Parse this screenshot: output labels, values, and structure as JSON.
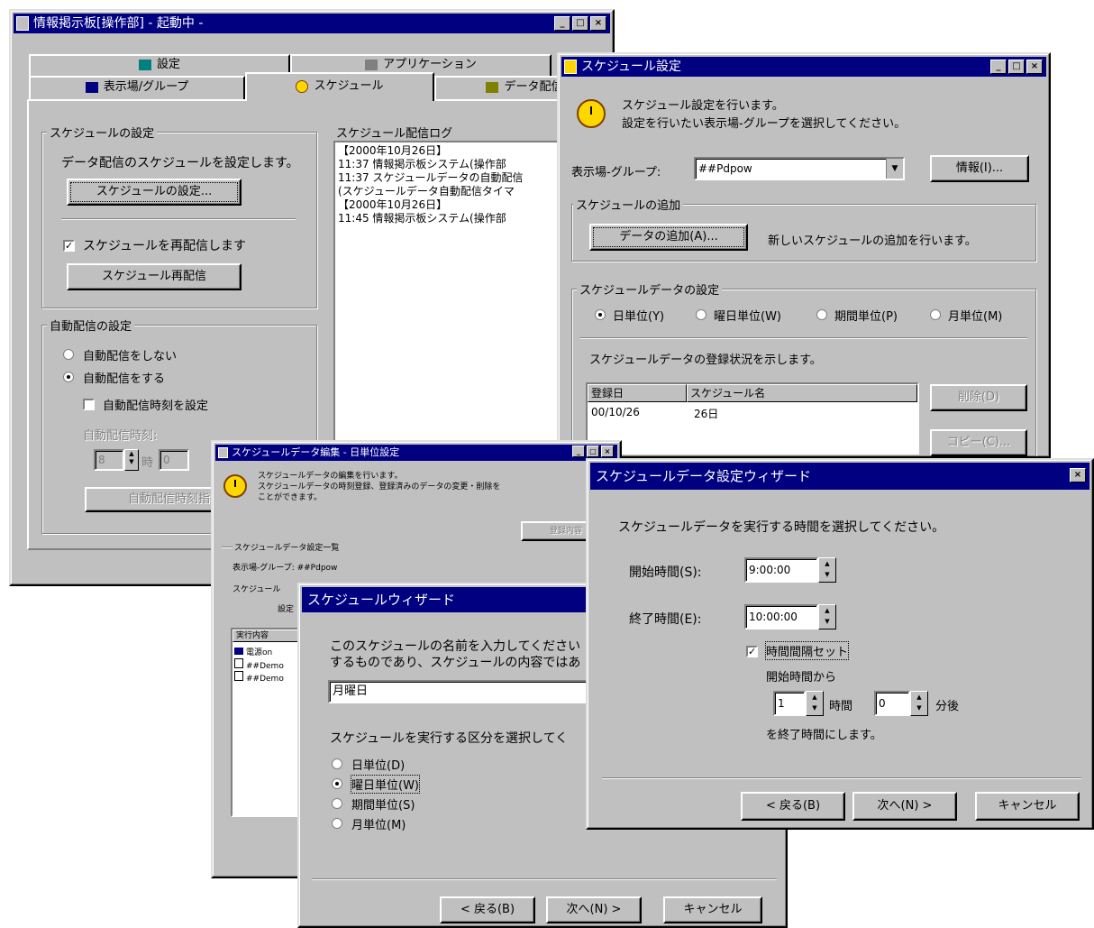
{
  "main_window": {
    "title": "情報掲示板[操作部] - 起動中 -",
    "tabs_row1": [
      "設定",
      "アプリケーション"
    ],
    "tabs_row2": [
      "表示場/グループ",
      "スケジュール",
      "データ配信"
    ],
    "schedule_group": {
      "label": "スケジュールの設定",
      "desc": "データ配信のスケジュールを設定します。",
      "button": "スケジュールの設定...",
      "redeliver_check": "スケジュールを再配信します",
      "redeliver_button": "スケジュール再配信"
    },
    "auto_group": {
      "label": "自動配信の設定",
      "radio_off": "自動配信をしない",
      "radio_on": "自動配信をする",
      "time_check": "自動配信時刻を設定",
      "time_label": "自動配信時刻:",
      "hour_value": "8",
      "hour_unit": "時",
      "minute_value": "0",
      "button": "自動配信時刻指定"
    },
    "log": {
      "label": "スケジュール配信ログ",
      "lines": [
        "【2000年10月26日】",
        "11:37 情報掲示板システム(操作部",
        "11:37 スケジュールデータの自動配信",
        "(スケジュールデータ自動配信タイマ",
        "【2000年10月26日】",
        "11:45 情報掲示板システム(操作部"
      ]
    }
  },
  "schedule_settings": {
    "title": "スケジュール設定",
    "intro1": "スケジュール設定を行います。",
    "intro2": "設定を行いたい表示場-グループを選択してください。",
    "group_label": "表示場-グループ:",
    "group_value": "##Pdpow",
    "info_button": "情報(I)...",
    "add_group": "スケジュールの追加",
    "add_button": "データの追加(A)...",
    "add_desc": "新しいスケジュールの追加を行います。",
    "data_group": "スケジュールデータの設定",
    "radios": [
      "日単位(Y)",
      "曜日単位(W)",
      "期間単位(P)",
      "月単位(M)"
    ],
    "status_text": "スケジュールデータの登録状況を示します。",
    "col_date": "登録日",
    "col_name": "スケジュール名",
    "row_date": "00/10/26",
    "row_name": "26日",
    "delete_button": "削除(D)",
    "copy_button": "コピー(C)..."
  },
  "data_edit": {
    "title": "スケジュールデータ編集 - 日単位設定",
    "line1": "スケジュールデータの編集を行います。",
    "line2": "スケジュールデータの時刻登録、登録済みのデータの変更・削除を",
    "line3": "ことができます。",
    "right_button": "登録内容",
    "list_label": "スケジュールデータ設定一覧",
    "group_line": "表示場-グループ: ##Pdpow",
    "schedule_label": "スケジュール",
    "setting_label": "設定",
    "col1": "実行内容",
    "items": [
      "電源on",
      "##Demo",
      "##Demo"
    ]
  },
  "schedule_wizard": {
    "title": "スケジュールウィザード",
    "prompt1": "このスケジュールの名前を入力してください",
    "prompt2": "するものであり、スケジュールの内容ではあ",
    "name_value": "月曜日",
    "division_prompt": "スケジュールを実行する区分を選択してく",
    "radios": [
      "日単位(D)",
      "曜日単位(W)",
      "期間単位(S)",
      "月単位(M)"
    ],
    "back": "< 戻る(B)",
    "next": "次へ(N) >",
    "cancel": "キャンセル"
  },
  "data_wizard": {
    "title": "スケジュールデータ設定ウィザード",
    "prompt": "スケジュールデータを実行する時間を選択してください。",
    "start_label": "開始時間(S):",
    "start_value": "9:00:00",
    "end_label": "終了時間(E):",
    "end_value": "10:00:00",
    "interval_check": "時間間隔セット",
    "from_label": "開始時間から",
    "hours_value": "1",
    "hours_unit": "時間",
    "minutes_value": "0",
    "minutes_unit": "分後",
    "suffix": "を終了時間にします。",
    "back": "< 戻る(B)",
    "next": "次へ(N) >",
    "cancel": "キャンセル"
  }
}
